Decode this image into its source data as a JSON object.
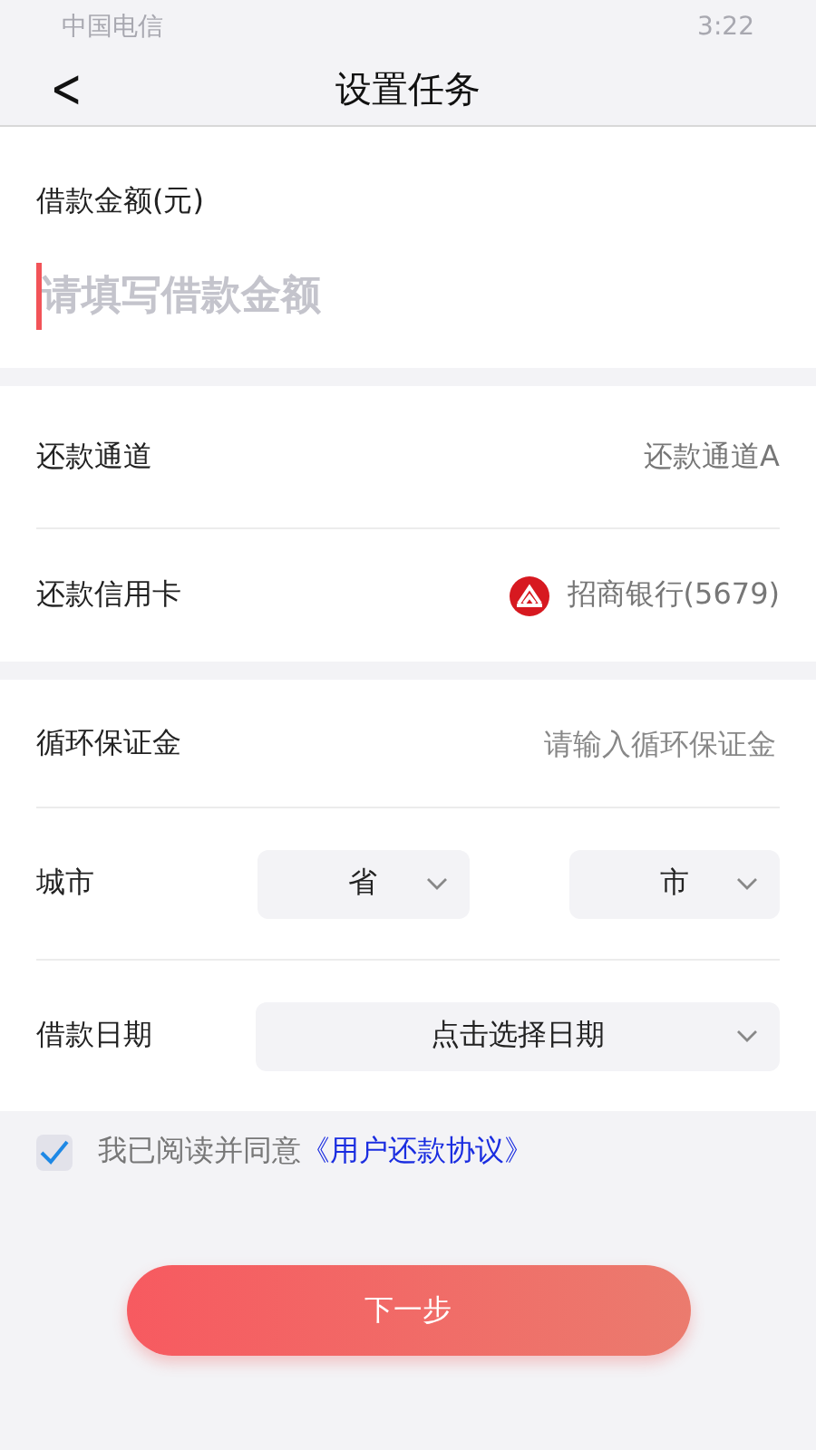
{
  "status_bar": {
    "carrier": "中国电信",
    "time": "3:22"
  },
  "nav": {
    "back": "<",
    "title": "设置任务"
  },
  "amount": {
    "label": "借款金额(元)",
    "placeholder": "请填写借款金额"
  },
  "channel": {
    "label": "还款通道",
    "value": "还款通道A"
  },
  "card": {
    "label": "还款信用卡",
    "value": "招商银行(5679)"
  },
  "deposit": {
    "label": "循环保证金",
    "placeholder": "请输入循环保证金"
  },
  "city": {
    "label": "城市",
    "province": "省",
    "city": "市"
  },
  "date": {
    "label": "借款日期",
    "value": "点击选择日期"
  },
  "agreement": {
    "checked": true,
    "text": "我已阅读并同意",
    "link": "《用户还款协议》"
  },
  "next_button": "下一步"
}
